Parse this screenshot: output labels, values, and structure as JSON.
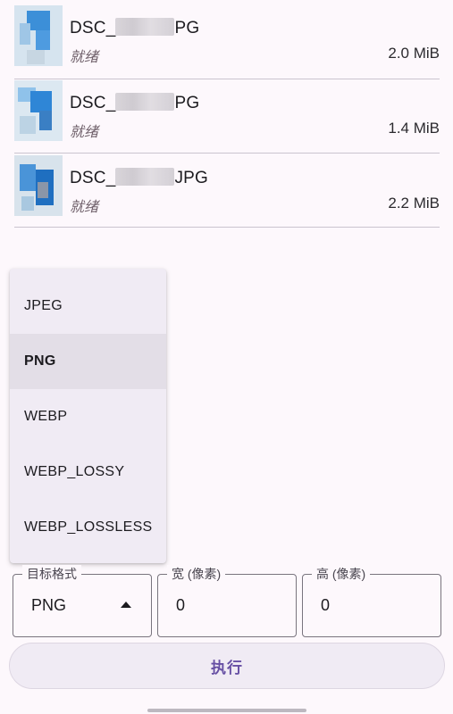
{
  "files": [
    {
      "name_prefix": "DSC_",
      "name_suffix": "PG",
      "status": "就绪",
      "size": "2.0 MiB"
    },
    {
      "name_prefix": "DSC_",
      "name_suffix": "PG",
      "status": "就绪",
      "size": "1.4 MiB"
    },
    {
      "name_prefix": "DSC_",
      "name_suffix": "JPG",
      "status": "就绪",
      "size": "2.2 MiB"
    }
  ],
  "format_menu": {
    "options": [
      "JPEG",
      "PNG",
      "WEBP",
      "WEBP_LOSSY",
      "WEBP_LOSSLESS"
    ],
    "selected": "PNG"
  },
  "controls": {
    "format_label": "目标格式",
    "format_value": "PNG",
    "width_label": "宽 (像素)",
    "width_value": "0",
    "height_label": "高 (像素)",
    "height_value": "0",
    "execute_label": "执行"
  },
  "colors": {
    "background": "#fdf8fc",
    "accent": "#6750a4",
    "menu_background": "#f0ebf4",
    "menu_selected": "#e3dee7"
  }
}
